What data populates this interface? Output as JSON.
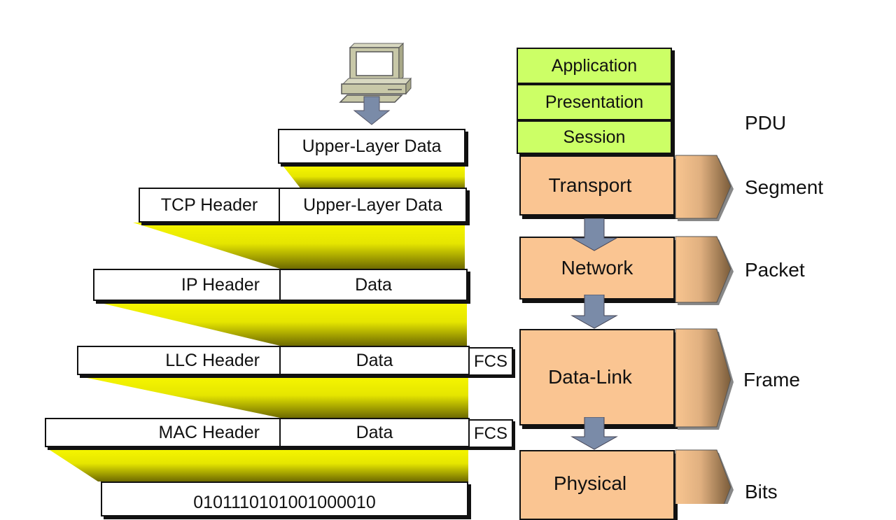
{
  "encapsulation": {
    "upper_layer_box": {
      "data": "Upper-Layer Data"
    },
    "tcp_box": {
      "header": "TCP Header",
      "data": "Upper-Layer Data"
    },
    "ip_box": {
      "header": "IP Header",
      "data": "Data"
    },
    "llc_box": {
      "header": "LLC Header",
      "data": "Data",
      "trailer": "FCS"
    },
    "mac_box": {
      "header": "MAC Header",
      "data": "Data",
      "trailer": "FCS"
    },
    "bits_box": {
      "data": "0101110101001000010"
    }
  },
  "osi_layers": {
    "application": "Application",
    "presentation": "Presentation",
    "session": "Session",
    "transport": "Transport",
    "network": "Network",
    "data_link": "Data-Link",
    "physical": "Physical"
  },
  "pdu": {
    "heading": "PDU",
    "segment": "Segment",
    "packet": "Packet",
    "frame": "Frame",
    "bits": "Bits"
  },
  "icons": {
    "computer": "computer-icon",
    "down_arrow": "down-arrow-icon"
  },
  "colors": {
    "upper_layers": "#ccff66",
    "lower_layers": "#fac592",
    "funnel_yellow": "#f0f000",
    "arrow_blue": "#7a8ba8"
  }
}
